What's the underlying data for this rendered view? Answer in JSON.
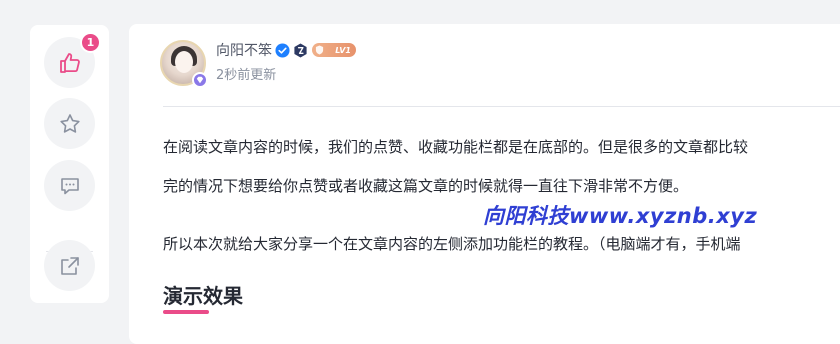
{
  "sidebar": {
    "like_count": "1",
    "icons": {
      "like": "thumbs-up-icon",
      "collect": "star-icon",
      "comment": "comment-icon",
      "share": "share-icon"
    }
  },
  "author": {
    "name": "向阳不笨",
    "level": "LV1",
    "updated": "2秒前更新"
  },
  "article": {
    "paragraphs": [
      "在阅读文章内容的时候，我们的点赞、收藏功能栏都是在底部的。但是很多的文章都比较",
      "完的情况下想要给你点赞或者收藏这篇文章的时候就得一直往下滑非常不方便。",
      "所以本次就给大家分享一个在文章内容的左侧添加功能栏的教程。（电脑端才有，手机端"
    ],
    "watermark": "向阳科技www.xyznb.xyz",
    "section_title": "演示效果"
  },
  "colors": {
    "accent_pink": "#ea4c89",
    "watermark_blue": "#2f3fd3",
    "like_icon": "#ea4c89",
    "icon_gray": "#8a919f"
  }
}
